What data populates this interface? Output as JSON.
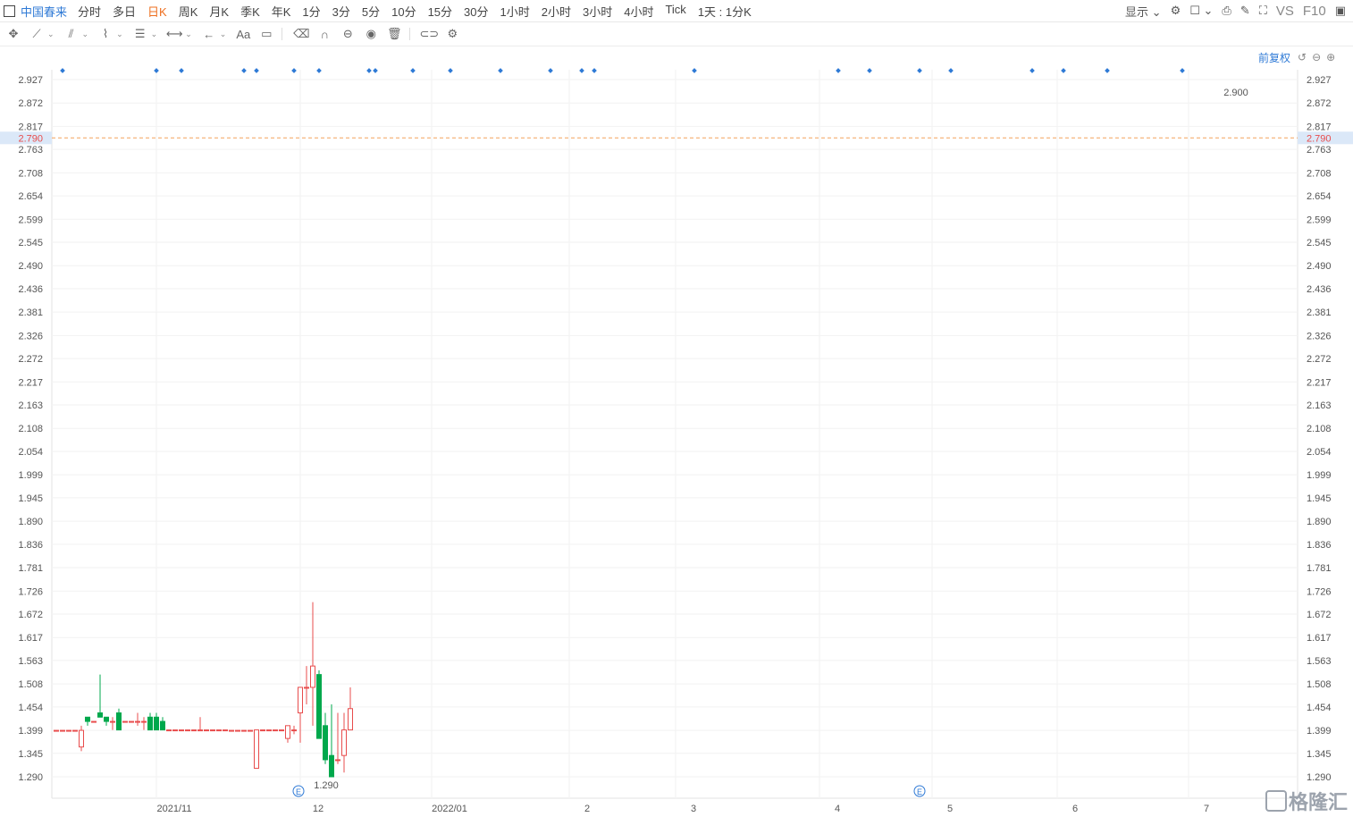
{
  "toolbar": {
    "stock_name": "中国春来",
    "timeframes": [
      "分时",
      "多日",
      "日K",
      "周K",
      "月K",
      "季K",
      "年K",
      "1分",
      "3分",
      "5分",
      "10分",
      "15分",
      "30分",
      "1小时",
      "2小时",
      "3小时",
      "4小时",
      "Tick",
      "1天 : 1分K"
    ],
    "active_timeframe": "日K",
    "display_label": "显示",
    "vs_label": "VS",
    "f10_label": "F10"
  },
  "drawing_tools": [
    "move-icon",
    "line-icon",
    "channel-icon",
    "wave-icon",
    "fib-icon",
    "measure-icon",
    "back-icon",
    "text-icon",
    "note-icon",
    "eraser-icon",
    "magnet-icon",
    "lock-icon",
    "eye-icon",
    "trash-icon",
    "compare-icon",
    "settings-icon"
  ],
  "adjust_label": "前复权",
  "watermark": "格隆汇",
  "colors": {
    "up": "#e84c4c",
    "down": "#00a84c",
    "accent": "#2f7ad6",
    "active": "#ee6f1f",
    "price_line": "#f3a25c"
  },
  "chart_data": {
    "type": "candlestick",
    "ylim": [
      1.26,
      2.96
    ],
    "y_ticks": [
      "2.927",
      "2.872",
      "2.817",
      "2.763",
      "2.708",
      "2.654",
      "2.599",
      "2.545",
      "2.490",
      "2.436",
      "2.381",
      "2.326",
      "2.272",
      "2.217",
      "2.163",
      "2.108",
      "2.054",
      "1.999",
      "1.945",
      "1.890",
      "1.836",
      "1.781",
      "1.726",
      "1.672",
      "1.617",
      "1.563",
      "1.508",
      "1.454",
      "1.399",
      "1.345",
      "1.290"
    ],
    "x_labels": [
      {
        "label": "2021/11",
        "index": 16
      },
      {
        "label": "12",
        "index": 39
      },
      {
        "label": "2022/01",
        "index": 60
      },
      {
        "label": "2",
        "index": 82
      },
      {
        "label": "3",
        "index": 99
      },
      {
        "label": "4",
        "index": 122
      },
      {
        "label": "5",
        "index": 140
      },
      {
        "label": "6",
        "index": 160
      },
      {
        "label": "7",
        "index": 181
      }
    ],
    "current_price": "2.790",
    "high_label": "2.900",
    "low_label": "1.290",
    "event_markers": [
      {
        "label": "E",
        "index": 37
      },
      {
        "label": "E",
        "index": 138
      }
    ],
    "dividend_dot_indices": [
      1,
      16,
      20,
      30,
      32,
      38,
      42,
      50,
      51,
      57,
      63,
      71,
      79,
      84,
      86,
      102,
      125,
      130,
      138,
      143,
      156,
      161,
      168,
      180
    ],
    "candles": [
      [
        1.399,
        1.399,
        1.399,
        1.399
      ],
      [
        1.399,
        1.399,
        1.399,
        1.399
      ],
      [
        1.399,
        1.399,
        1.399,
        1.399
      ],
      [
        1.399,
        1.399,
        1.399,
        1.399
      ],
      [
        1.36,
        1.41,
        1.35,
        1.399
      ],
      [
        1.43,
        1.43,
        1.41,
        1.42
      ],
      [
        1.42,
        1.42,
        1.42,
        1.42
      ],
      [
        1.44,
        1.53,
        1.43,
        1.43
      ],
      [
        1.43,
        1.43,
        1.41,
        1.42
      ],
      [
        1.42,
        1.43,
        1.4,
        1.42
      ],
      [
        1.44,
        1.45,
        1.4,
        1.4
      ],
      [
        1.42,
        1.42,
        1.42,
        1.42
      ],
      [
        1.42,
        1.42,
        1.42,
        1.42
      ],
      [
        1.42,
        1.44,
        1.41,
        1.42
      ],
      [
        1.42,
        1.43,
        1.4,
        1.42
      ],
      [
        1.43,
        1.44,
        1.4,
        1.4
      ],
      [
        1.43,
        1.44,
        1.4,
        1.4
      ],
      [
        1.42,
        1.43,
        1.4,
        1.4
      ],
      [
        1.4,
        1.4,
        1.4,
        1.4
      ],
      [
        1.4,
        1.4,
        1.4,
        1.4
      ],
      [
        1.4,
        1.4,
        1.4,
        1.4
      ],
      [
        1.4,
        1.4,
        1.4,
        1.4
      ],
      [
        1.4,
        1.4,
        1.4,
        1.4
      ],
      [
        1.4,
        1.43,
        1.4,
        1.4
      ],
      [
        1.4,
        1.4,
        1.4,
        1.4
      ],
      [
        1.4,
        1.4,
        1.4,
        1.4
      ],
      [
        1.4,
        1.4,
        1.4,
        1.4
      ],
      [
        1.4,
        1.4,
        1.4,
        1.4
      ],
      [
        1.399,
        1.399,
        1.399,
        1.399
      ],
      [
        1.399,
        1.399,
        1.399,
        1.399
      ],
      [
        1.399,
        1.399,
        1.399,
        1.399
      ],
      [
        1.399,
        1.399,
        1.399,
        1.399
      ],
      [
        1.31,
        1.4,
        1.31,
        1.4
      ],
      [
        1.4,
        1.4,
        1.4,
        1.4
      ],
      [
        1.4,
        1.4,
        1.4,
        1.4
      ],
      [
        1.4,
        1.4,
        1.4,
        1.4
      ],
      [
        1.4,
        1.4,
        1.4,
        1.4
      ],
      [
        1.38,
        1.41,
        1.37,
        1.41
      ],
      [
        1.4,
        1.41,
        1.39,
        1.4
      ],
      [
        1.44,
        1.5,
        1.37,
        1.5
      ],
      [
        1.5,
        1.55,
        1.46,
        1.5
      ],
      [
        1.5,
        1.7,
        1.41,
        1.55
      ],
      [
        1.53,
        1.54,
        1.38,
        1.38
      ],
      [
        1.41,
        1.44,
        1.32,
        1.33
      ],
      [
        1.34,
        1.46,
        1.31,
        1.29
      ],
      [
        1.33,
        1.44,
        1.32,
        1.33
      ],
      [
        1.34,
        1.44,
        1.3,
        1.4
      ],
      [
        1.4,
        1.5,
        1.4,
        1.45
      ]
    ]
  }
}
